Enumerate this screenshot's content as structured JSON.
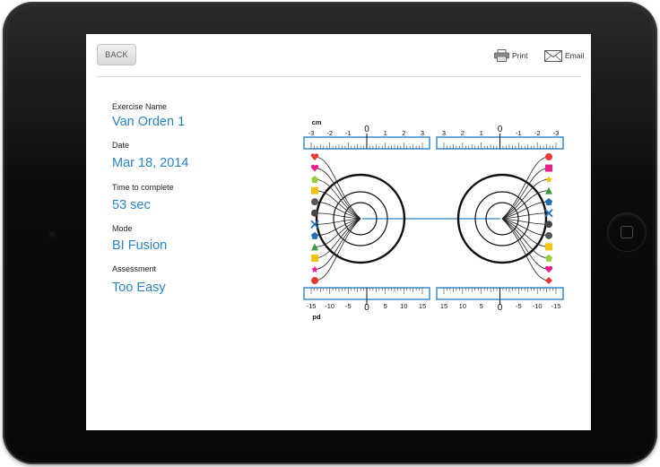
{
  "toolbar": {
    "back_label": "BACK",
    "print_label": "Print",
    "email_label": "Email"
  },
  "fields": [
    {
      "label": "Exercise Name",
      "value": "Van Orden 1"
    },
    {
      "label": "Date",
      "value": "Mar 18, 2014"
    },
    {
      "label": "Time to complete",
      "value": "53 sec"
    },
    {
      "label": "Mode",
      "value": "BI Fusion"
    },
    {
      "label": "Assessment",
      "value": "Too Easy"
    }
  ],
  "diagram": {
    "top_unit": "cm",
    "bottom_unit": "pd",
    "top_left_ticks": [
      "-3",
      "-2",
      "-1",
      "0",
      "1",
      "2",
      "3"
    ],
    "top_right_ticks": [
      "3",
      "2",
      "1",
      "0",
      "-1",
      "-2",
      "-3"
    ],
    "bottom_left_ticks": [
      "-15",
      "-10",
      "-5",
      "0",
      "5",
      "10",
      "15"
    ],
    "bottom_right_ticks": [
      "15",
      "10",
      "5",
      "0",
      "-5",
      "-10",
      "-15"
    ],
    "accent_color": "#2b83c6",
    "left_markers": [
      "heart",
      "heart",
      "pentagon",
      "square",
      "circle",
      "circle",
      "x",
      "pentagon",
      "triangle",
      "square",
      "star",
      "circle"
    ],
    "right_markers": [
      "circle",
      "square",
      "star",
      "triangle",
      "pentagon",
      "x",
      "circle",
      "circle",
      "square",
      "pentagon",
      "heart",
      "diamond"
    ]
  }
}
